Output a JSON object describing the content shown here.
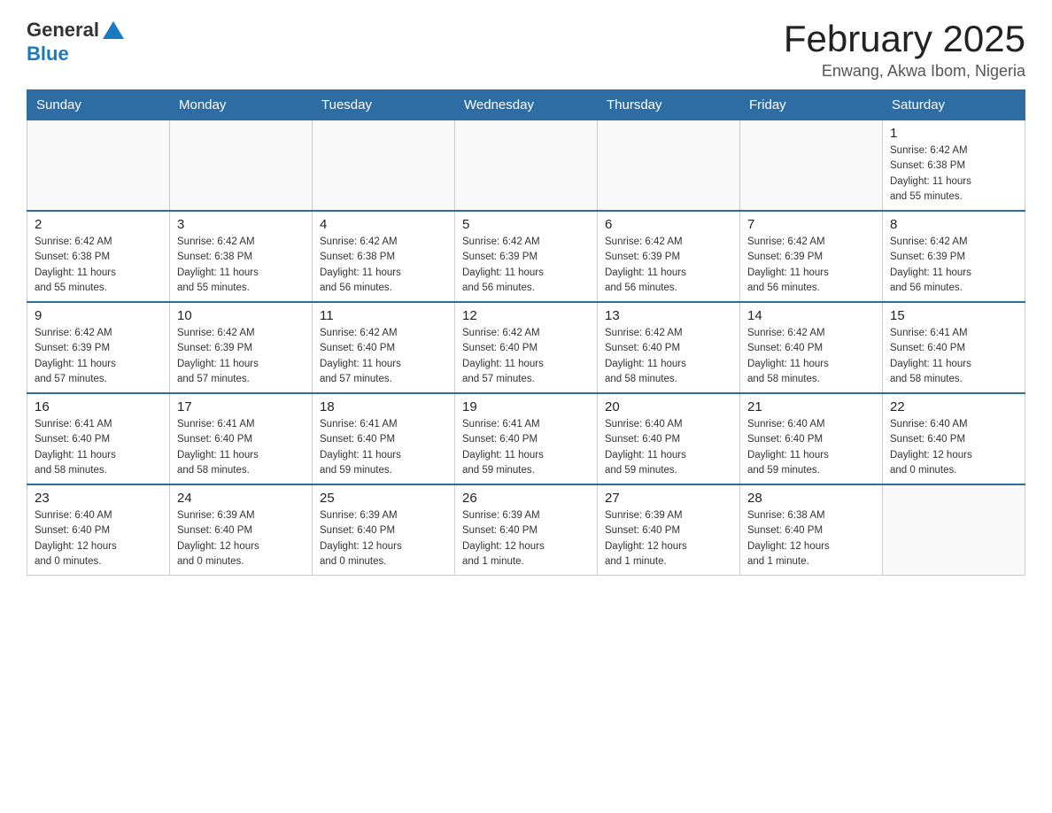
{
  "logo": {
    "text_general": "General",
    "text_blue": "Blue"
  },
  "header": {
    "title": "February 2025",
    "location": "Enwang, Akwa Ibom, Nigeria"
  },
  "weekdays": [
    "Sunday",
    "Monday",
    "Tuesday",
    "Wednesday",
    "Thursday",
    "Friday",
    "Saturday"
  ],
  "weeks": [
    {
      "days": [
        {
          "date": "",
          "info": ""
        },
        {
          "date": "",
          "info": ""
        },
        {
          "date": "",
          "info": ""
        },
        {
          "date": "",
          "info": ""
        },
        {
          "date": "",
          "info": ""
        },
        {
          "date": "",
          "info": ""
        },
        {
          "date": "1",
          "info": "Sunrise: 6:42 AM\nSunset: 6:38 PM\nDaylight: 11 hours\nand 55 minutes."
        }
      ]
    },
    {
      "days": [
        {
          "date": "2",
          "info": "Sunrise: 6:42 AM\nSunset: 6:38 PM\nDaylight: 11 hours\nand 55 minutes."
        },
        {
          "date": "3",
          "info": "Sunrise: 6:42 AM\nSunset: 6:38 PM\nDaylight: 11 hours\nand 55 minutes."
        },
        {
          "date": "4",
          "info": "Sunrise: 6:42 AM\nSunset: 6:38 PM\nDaylight: 11 hours\nand 56 minutes."
        },
        {
          "date": "5",
          "info": "Sunrise: 6:42 AM\nSunset: 6:39 PM\nDaylight: 11 hours\nand 56 minutes."
        },
        {
          "date": "6",
          "info": "Sunrise: 6:42 AM\nSunset: 6:39 PM\nDaylight: 11 hours\nand 56 minutes."
        },
        {
          "date": "7",
          "info": "Sunrise: 6:42 AM\nSunset: 6:39 PM\nDaylight: 11 hours\nand 56 minutes."
        },
        {
          "date": "8",
          "info": "Sunrise: 6:42 AM\nSunset: 6:39 PM\nDaylight: 11 hours\nand 56 minutes."
        }
      ]
    },
    {
      "days": [
        {
          "date": "9",
          "info": "Sunrise: 6:42 AM\nSunset: 6:39 PM\nDaylight: 11 hours\nand 57 minutes."
        },
        {
          "date": "10",
          "info": "Sunrise: 6:42 AM\nSunset: 6:39 PM\nDaylight: 11 hours\nand 57 minutes."
        },
        {
          "date": "11",
          "info": "Sunrise: 6:42 AM\nSunset: 6:40 PM\nDaylight: 11 hours\nand 57 minutes."
        },
        {
          "date": "12",
          "info": "Sunrise: 6:42 AM\nSunset: 6:40 PM\nDaylight: 11 hours\nand 57 minutes."
        },
        {
          "date": "13",
          "info": "Sunrise: 6:42 AM\nSunset: 6:40 PM\nDaylight: 11 hours\nand 58 minutes."
        },
        {
          "date": "14",
          "info": "Sunrise: 6:42 AM\nSunset: 6:40 PM\nDaylight: 11 hours\nand 58 minutes."
        },
        {
          "date": "15",
          "info": "Sunrise: 6:41 AM\nSunset: 6:40 PM\nDaylight: 11 hours\nand 58 minutes."
        }
      ]
    },
    {
      "days": [
        {
          "date": "16",
          "info": "Sunrise: 6:41 AM\nSunset: 6:40 PM\nDaylight: 11 hours\nand 58 minutes."
        },
        {
          "date": "17",
          "info": "Sunrise: 6:41 AM\nSunset: 6:40 PM\nDaylight: 11 hours\nand 58 minutes."
        },
        {
          "date": "18",
          "info": "Sunrise: 6:41 AM\nSunset: 6:40 PM\nDaylight: 11 hours\nand 59 minutes."
        },
        {
          "date": "19",
          "info": "Sunrise: 6:41 AM\nSunset: 6:40 PM\nDaylight: 11 hours\nand 59 minutes."
        },
        {
          "date": "20",
          "info": "Sunrise: 6:40 AM\nSunset: 6:40 PM\nDaylight: 11 hours\nand 59 minutes."
        },
        {
          "date": "21",
          "info": "Sunrise: 6:40 AM\nSunset: 6:40 PM\nDaylight: 11 hours\nand 59 minutes."
        },
        {
          "date": "22",
          "info": "Sunrise: 6:40 AM\nSunset: 6:40 PM\nDaylight: 12 hours\nand 0 minutes."
        }
      ]
    },
    {
      "days": [
        {
          "date": "23",
          "info": "Sunrise: 6:40 AM\nSunset: 6:40 PM\nDaylight: 12 hours\nand 0 minutes."
        },
        {
          "date": "24",
          "info": "Sunrise: 6:39 AM\nSunset: 6:40 PM\nDaylight: 12 hours\nand 0 minutes."
        },
        {
          "date": "25",
          "info": "Sunrise: 6:39 AM\nSunset: 6:40 PM\nDaylight: 12 hours\nand 0 minutes."
        },
        {
          "date": "26",
          "info": "Sunrise: 6:39 AM\nSunset: 6:40 PM\nDaylight: 12 hours\nand 1 minute."
        },
        {
          "date": "27",
          "info": "Sunrise: 6:39 AM\nSunset: 6:40 PM\nDaylight: 12 hours\nand 1 minute."
        },
        {
          "date": "28",
          "info": "Sunrise: 6:38 AM\nSunset: 6:40 PM\nDaylight: 12 hours\nand 1 minute."
        },
        {
          "date": "",
          "info": ""
        }
      ]
    }
  ]
}
